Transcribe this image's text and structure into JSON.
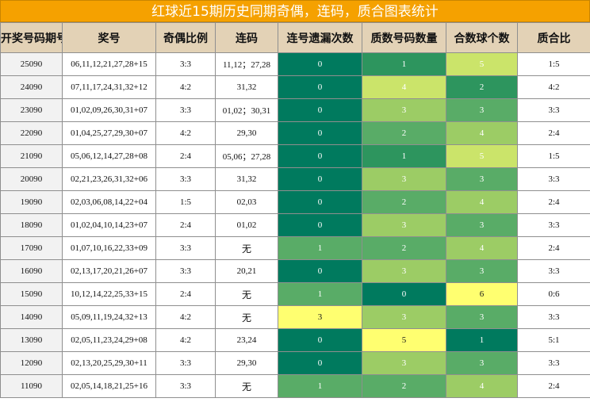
{
  "title": "红球近15期历史同期奇偶，连码，质合图表统计",
  "headers": [
    "开奖号码期号",
    "奖号",
    "奇偶比例",
    "连码",
    "连号遗漏次数",
    "质数号码数量",
    "合数球个数",
    "质合比"
  ],
  "rows": [
    {
      "period": "25090",
      "numbers": "06,11,12,21,27,28+15",
      "odd_even": "3:3",
      "consecutive": "11,12；27,28",
      "gap": "0",
      "prime": "1",
      "composite": "5",
      "ratio": "1:5"
    },
    {
      "period": "24090",
      "numbers": "07,11,17,24,31,32+12",
      "odd_even": "4:2",
      "consecutive": "31,32",
      "gap": "0",
      "prime": "4",
      "composite": "2",
      "ratio": "4:2"
    },
    {
      "period": "23090",
      "numbers": "01,02,09,26,30,31+07",
      "odd_even": "3:3",
      "consecutive": "01,02；30,31",
      "gap": "0",
      "prime": "3",
      "composite": "3",
      "ratio": "3:3"
    },
    {
      "period": "22090",
      "numbers": "01,04,25,27,29,30+07",
      "odd_even": "4:2",
      "consecutive": "29,30",
      "gap": "0",
      "prime": "2",
      "composite": "4",
      "ratio": "2:4"
    },
    {
      "period": "21090",
      "numbers": "05,06,12,14,27,28+08",
      "odd_even": "2:4",
      "consecutive": "05,06；27,28",
      "gap": "0",
      "prime": "1",
      "composite": "5",
      "ratio": "1:5"
    },
    {
      "period": "20090",
      "numbers": "02,21,23,26,31,32+06",
      "odd_even": "3:3",
      "consecutive": "31,32",
      "gap": "0",
      "prime": "3",
      "composite": "3",
      "ratio": "3:3"
    },
    {
      "period": "19090",
      "numbers": "02,03,06,08,14,22+04",
      "odd_even": "1:5",
      "consecutive": "02,03",
      "gap": "0",
      "prime": "2",
      "composite": "4",
      "ratio": "2:4"
    },
    {
      "period": "18090",
      "numbers": "01,02,04,10,14,23+07",
      "odd_even": "2:4",
      "consecutive": "01,02",
      "gap": "0",
      "prime": "3",
      "composite": "3",
      "ratio": "3:3"
    },
    {
      "period": "17090",
      "numbers": "01,07,10,16,22,33+09",
      "odd_even": "3:3",
      "consecutive": "无",
      "gap": "1",
      "prime": "2",
      "composite": "4",
      "ratio": "2:4"
    },
    {
      "period": "16090",
      "numbers": "02,13,17,20,21,26+07",
      "odd_even": "3:3",
      "consecutive": "20,21",
      "gap": "0",
      "prime": "3",
      "composite": "3",
      "ratio": "3:3"
    },
    {
      "period": "15090",
      "numbers": "10,12,14,22,25,33+15",
      "odd_even": "2:4",
      "consecutive": "无",
      "gap": "1",
      "prime": "0",
      "composite": "6",
      "ratio": "0:6"
    },
    {
      "period": "14090",
      "numbers": "05,09,11,19,24,32+13",
      "odd_even": "4:2",
      "consecutive": "无",
      "gap": "3",
      "prime": "3",
      "composite": "3",
      "ratio": "3:3"
    },
    {
      "period": "13090",
      "numbers": "02,05,11,23,24,29+08",
      "odd_even": "4:2",
      "consecutive": "23,24",
      "gap": "0",
      "prime": "5",
      "composite": "1",
      "ratio": "5:1"
    },
    {
      "period": "12090",
      "numbers": "02,13,20,25,29,30+11",
      "odd_even": "3:3",
      "consecutive": "29,30",
      "gap": "0",
      "prime": "3",
      "composite": "3",
      "ratio": "3:3"
    },
    {
      "period": "11090",
      "numbers": "02,05,14,18,21,25+16",
      "odd_even": "3:3",
      "consecutive": "无",
      "gap": "1",
      "prime": "2",
      "composite": "4",
      "ratio": "2:4"
    }
  ],
  "scales": {
    "gap": {
      "0": "#007a5e",
      "1": "#59ac67",
      "3": "#ffff70"
    },
    "prime": {
      "0": "#007a5e",
      "1": "#2d955e",
      "2": "#59ac67",
      "3": "#9ccc65",
      "4": "#cbe46a",
      "5": "#ffff70"
    },
    "composite": {
      "1": "#007a5e",
      "2": "#2d955e",
      "3": "#59ac67",
      "4": "#9ccc65",
      "5": "#cbe46a",
      "6": "#ffff70"
    }
  }
}
